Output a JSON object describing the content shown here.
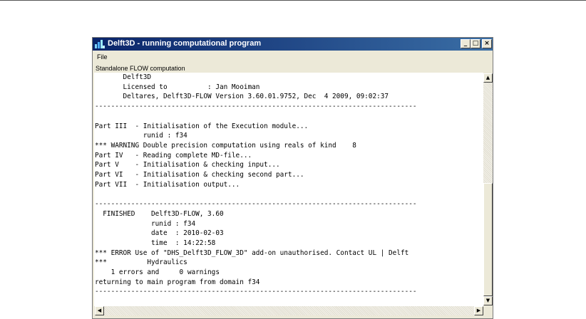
{
  "window": {
    "title": "Delft3D - running computational program",
    "controls": {
      "minimize": "_",
      "maximize": "□",
      "close": "×"
    }
  },
  "menu": {
    "file_label": "File"
  },
  "status_label": "Standalone FLOW computation",
  "output_lines": [
    "       Delft3D",
    "       Licensed to          : Jan Mooiman",
    "       Deltares, Delft3D-FLOW Version 3.60.01.9752, Dec  4 2009, 09:02:37",
    "--------------------------------------------------------------------------------",
    "",
    "Part III  - Initialisation of the Execution module...",
    "            runid : f34",
    "*** WARNING Double precision computation using reals of kind    8",
    "Part IV   - Reading complete MD-file...",
    "Part V    - Initialisation & checking input...",
    "Part VI   - Initialisation & checking second part...",
    "Part VII  - Initialisation output...",
    "",
    "--------------------------------------------------------------------------------",
    "  FINISHED    Delft3D-FLOW, 3.60",
    "              runid : f34",
    "              date  : 2010-02-03",
    "              time  : 14:22:58",
    "*** ERROR Use of \"DHS_Delft3D_FLOW_3D\" add-on unauthorised. Contact UL | Delft",
    "***          Hydraulics",
    "    1 errors and     0 warnings",
    "returning to main program from domain f34",
    "--------------------------------------------------------------------------------"
  ],
  "icons": {
    "app": "delft3d-app-icon",
    "scroll_up": "arrow-up-icon",
    "scroll_down": "arrow-down-icon",
    "scroll_left": "arrow-left-icon",
    "scroll_right": "arrow-right-icon"
  }
}
